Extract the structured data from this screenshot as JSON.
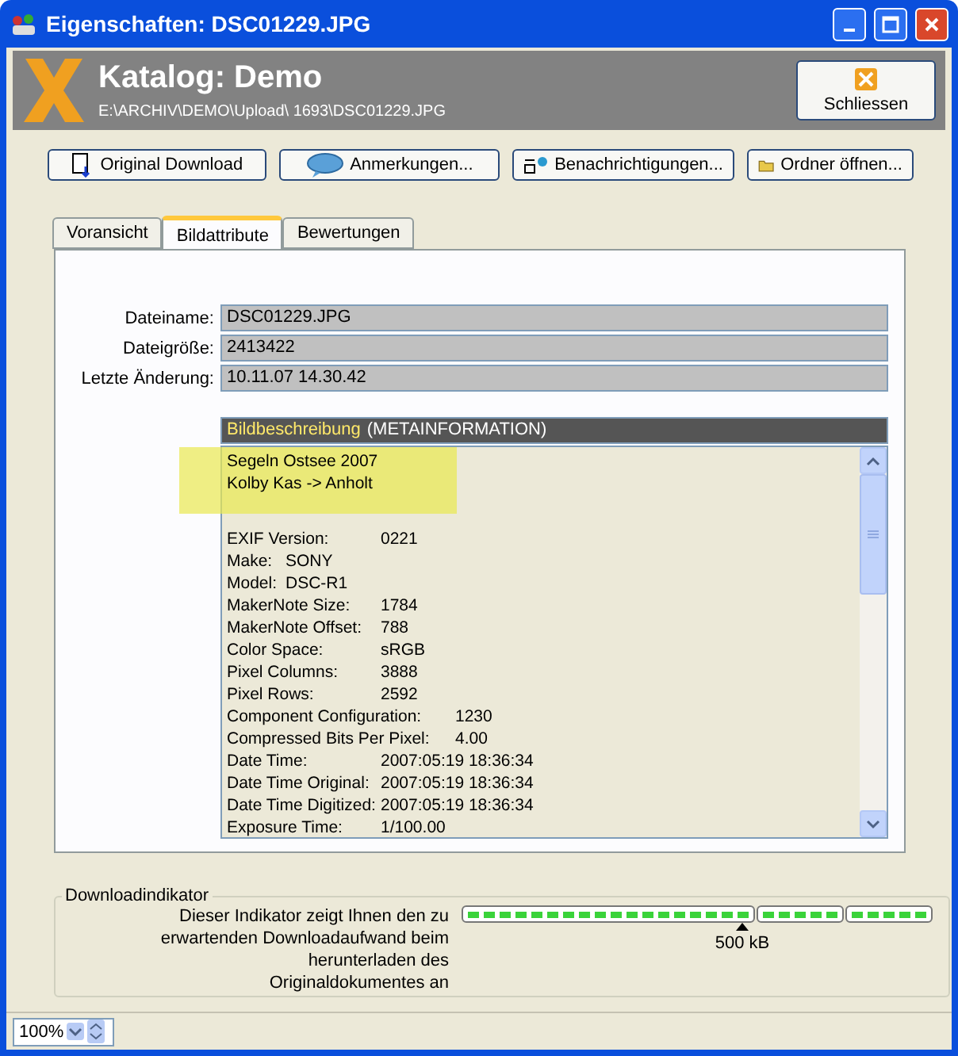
{
  "window": {
    "title": "Eigenschaften: DSC01229.JPG"
  },
  "header": {
    "title": "Katalog: Demo",
    "path": "E:\\ARCHIV\\DEMO\\Upload\\ 1693\\DSC01229.JPG",
    "close_button": "Schliessen"
  },
  "toolbar": [
    {
      "label": "Original Download",
      "kind": "download"
    },
    {
      "label": "Anmerkungen...",
      "kind": "comments"
    },
    {
      "label": "Benachrichtigungen...",
      "kind": "notify"
    },
    {
      "label": "Ordner öffnen...",
      "kind": "folder"
    }
  ],
  "tabs": [
    {
      "label": "Voransicht",
      "selected": false
    },
    {
      "label": "Bildattribute",
      "selected": true
    },
    {
      "label": "Bewertungen",
      "selected": false
    }
  ],
  "fields": [
    {
      "label": "Dateiname:",
      "value": "DSC01229.JPG"
    },
    {
      "label": "Dateigröße:",
      "value": "2413422"
    },
    {
      "label": "Letzte Änderung:",
      "value": "10.11.07 14.30.42"
    }
  ],
  "meta": {
    "header_label": "Bildbeschreibung",
    "header_note": "(METAINFORMATION)",
    "description": [
      "Segeln Ostsee 2007",
      "Kolby Kas -> Anholt"
    ],
    "lines": [
      {
        "label": "EXIF Version:",
        "value": "0221",
        "kind": "mid"
      },
      {
        "label": "Make:",
        "value": "SONY",
        "kind": "short"
      },
      {
        "label": "Model:",
        "value": "DSC-R1",
        "kind": "short"
      },
      {
        "label": "MakerNote Size:",
        "value": "1784",
        "kind": "mid"
      },
      {
        "label": "MakerNote Offset:",
        "value": "788",
        "kind": "mid"
      },
      {
        "label": "Color Space:",
        "value": "sRGB",
        "kind": "mid"
      },
      {
        "label": "Pixel Columns:",
        "value": "3888",
        "kind": "mid"
      },
      {
        "label": "Pixel Rows:",
        "value": "2592",
        "kind": "mid"
      },
      {
        "label": "Component Configuration:",
        "value": "1230",
        "kind": "long"
      },
      {
        "label": "Compressed Bits Per Pixel:",
        "value": "4.00",
        "kind": "long"
      },
      {
        "label": "Date Time:",
        "value": "2007:05:19 18:36:34",
        "kind": "mid"
      },
      {
        "label": "Date Time Original:",
        "value": "2007:05:19 18:36:34",
        "kind": "mid"
      },
      {
        "label": "Date Time Digitized:",
        "value": "2007:05:19 18:36:34",
        "kind": "mid"
      },
      {
        "label": "Exposure Time:",
        "value": "1/100.00",
        "kind": "mid"
      }
    ]
  },
  "download_indicator": {
    "legend": "Downloadindikator",
    "text": "Dieser Indikator zeigt Ihnen den zu erwartenden Downloadaufwand beim herunterladen des Originaldokumentes an",
    "level": 1,
    "marker": "500 kB"
  },
  "status_bar": {
    "zoom": "100%"
  }
}
